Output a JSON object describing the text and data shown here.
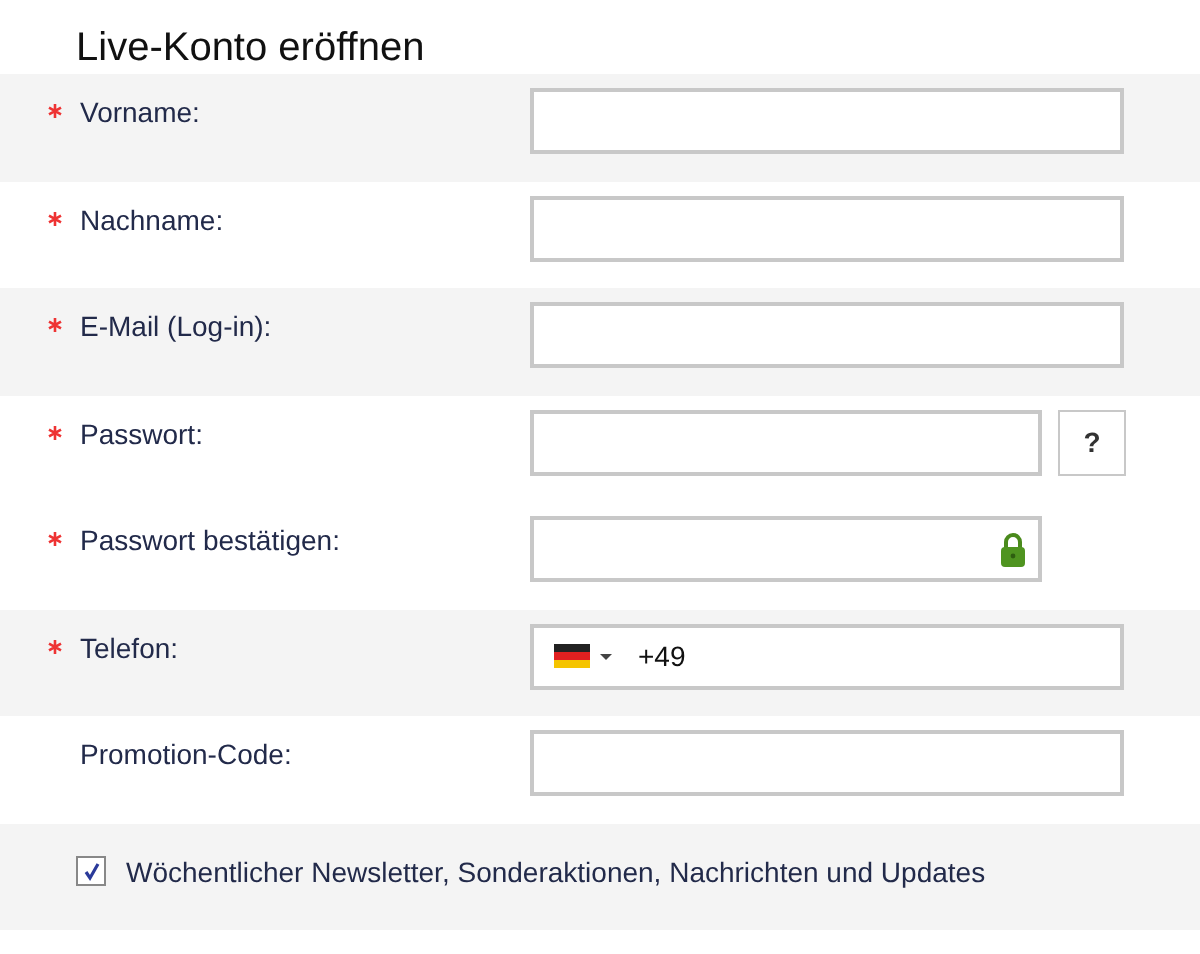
{
  "title": "Live-Konto eröffnen",
  "fields": [
    {
      "label": "Vorname:",
      "required": true,
      "kind": "text"
    },
    {
      "label": "Nachname:",
      "required": true,
      "kind": "text"
    },
    {
      "label": "E-Mail (Log-in):",
      "required": true,
      "kind": "text"
    },
    {
      "label": "Passwort:",
      "required": true,
      "kind": "help",
      "help": "?"
    },
    {
      "label": "Passwort bestätigen:",
      "required": true,
      "kind": "lock"
    },
    {
      "label": "Telefon:",
      "required": true,
      "kind": "phone",
      "value": "+49"
    },
    {
      "label": "Promotion-Code:",
      "required": false,
      "kind": "text"
    }
  ],
  "newsletter": {
    "label": "Wöchentlicher Newsletter, Sonderaktionen, Nachrichten und Updates",
    "checked": true
  }
}
